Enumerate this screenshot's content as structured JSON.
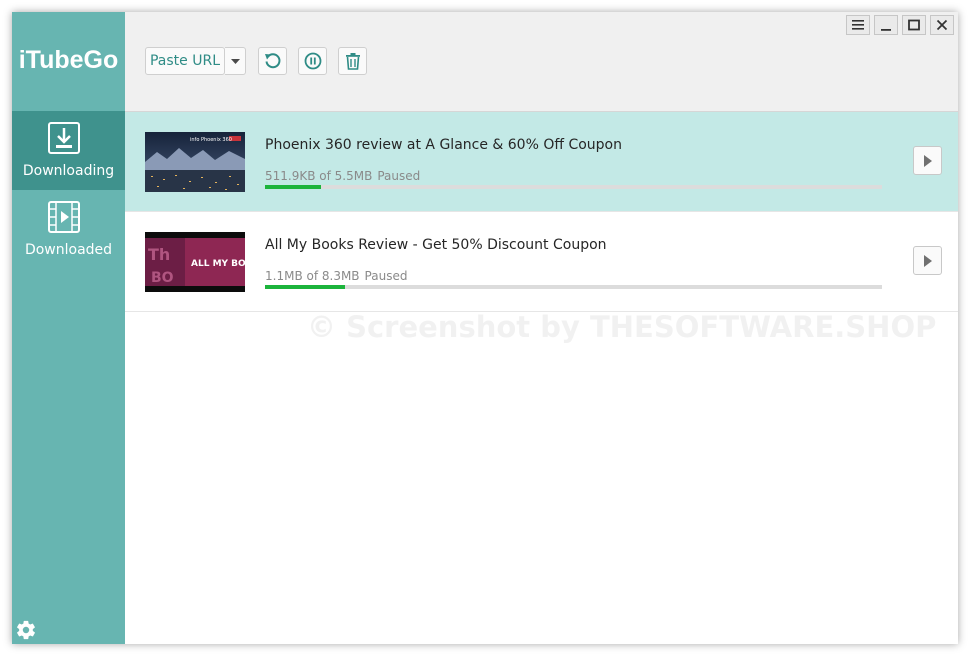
{
  "app": {
    "title": "iTubeGo"
  },
  "sidebar": {
    "items": [
      {
        "label": "Downloading",
        "icon": "download-tray-icon",
        "active": true
      },
      {
        "label": "Downloaded",
        "icon": "film-icon",
        "active": false
      }
    ],
    "settings_icon": "gear-icon"
  },
  "toolbar": {
    "paste_url_label": "Paste URL",
    "dropdown_icon": "caret-down-icon",
    "buttons": [
      "refresh-icon",
      "pause-circle-icon",
      "trash-icon"
    ]
  },
  "window_controls": [
    "menu-icon",
    "minimize-icon",
    "maximize-icon",
    "close-icon"
  ],
  "downloads": [
    {
      "title": "Phoenix 360 review at A Glance & 60% Off Coupon",
      "size_text": "511.9KB of 5.5MB",
      "state": "Paused",
      "progress": 0.09,
      "selected": true
    },
    {
      "title": "All My Books Review - Get 50% Discount Coupon",
      "size_text": "1.1MB of 8.3MB",
      "state": "Paused",
      "progress": 0.13,
      "selected": false
    }
  ],
  "thumbnails": {
    "first_caption": "info Phoenix 360",
    "second_caption": "ALL MY BOOKS"
  },
  "watermark": "© Screenshot by THESOFTWARE.SHOP",
  "colors": {
    "sidebar": "#67b5b1",
    "sidebar_active": "#3f928d",
    "selected_row": "#c3e9e6",
    "progress": "#1cb43c",
    "accent_text": "#2f8c86"
  }
}
